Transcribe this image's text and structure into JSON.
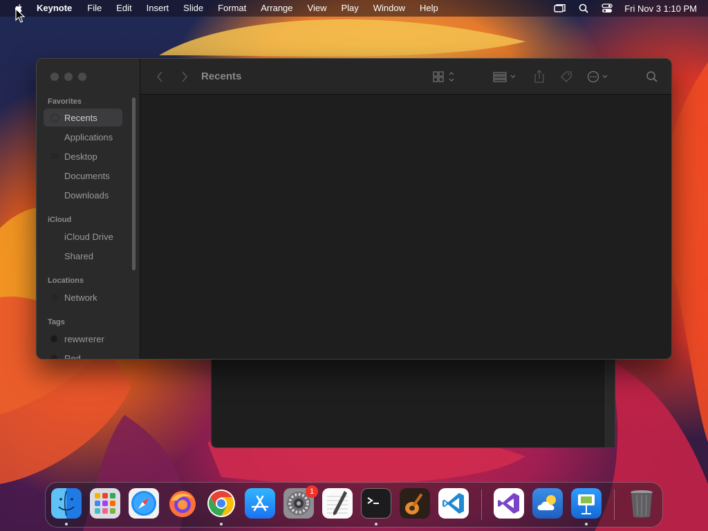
{
  "menubar": {
    "apple_icon": "apple-icon",
    "app_name": "Keynote",
    "items": [
      "File",
      "Edit",
      "Insert",
      "Slide",
      "Format",
      "Arrange",
      "View",
      "Play",
      "Window",
      "Help"
    ],
    "status_icons": [
      "screen-mirroring-icon",
      "spotlight-search-icon",
      "control-center-icon"
    ],
    "clock": "Fri Nov 3  1:10 PM"
  },
  "finder": {
    "title": "Recents",
    "toolbar_icons": [
      "back-icon",
      "forward-icon",
      "icon-view-icon",
      "group-by-icon",
      "share-icon",
      "tag-icon",
      "more-actions-icon",
      "search-icon"
    ],
    "sidebar": {
      "favorites_header": "Favorites",
      "favorites": [
        {
          "label": "Recents",
          "icon": "clock-icon"
        },
        {
          "label": "Applications",
          "icon": "applications-icon"
        },
        {
          "label": "Desktop",
          "icon": "desktop-icon"
        },
        {
          "label": "Documents",
          "icon": "document-icon"
        },
        {
          "label": "Downloads",
          "icon": "download-icon"
        }
      ],
      "icloud_header": "iCloud",
      "icloud": [
        {
          "label": "iCloud Drive",
          "icon": "cloud-icon"
        },
        {
          "label": "Shared",
          "icon": "shared-folder-icon"
        }
      ],
      "locations_header": "Locations",
      "locations": [
        {
          "label": "Network",
          "icon": "network-icon"
        }
      ],
      "tags_header": "Tags",
      "tags": [
        {
          "label": "rewwrerer",
          "color": "#1a1a1a"
        },
        {
          "label": "Red",
          "color": "#2a1a1a"
        }
      ]
    }
  },
  "dock": {
    "apps": [
      {
        "name": "Finder",
        "icon": "finder-icon",
        "running": true
      },
      {
        "name": "Launchpad",
        "icon": "launchpad-icon",
        "running": false
      },
      {
        "name": "Safari",
        "icon": "safari-icon",
        "running": false
      },
      {
        "name": "Firefox",
        "icon": "firefox-icon",
        "running": false
      },
      {
        "name": "Google Chrome",
        "icon": "chrome-icon",
        "running": true
      },
      {
        "name": "App Store",
        "icon": "app-store-icon",
        "running": false
      },
      {
        "name": "System Settings",
        "icon": "system-settings-icon",
        "running": false,
        "badge": "1"
      },
      {
        "name": "TextEdit",
        "icon": "textedit-icon",
        "running": false
      },
      {
        "name": "Terminal",
        "icon": "terminal-icon",
        "running": true
      },
      {
        "name": "GarageBand",
        "icon": "garageband-icon",
        "running": false
      },
      {
        "name": "Visual Studio Code",
        "icon": "vscode-icon",
        "running": false
      },
      {
        "name": "Visual Studio",
        "icon": "visual-studio-icon",
        "running": false
      },
      {
        "name": "Weather",
        "icon": "weather-icon",
        "running": false
      },
      {
        "name": "Keynote",
        "icon": "keynote-icon",
        "running": true
      },
      {
        "name": "Trash",
        "icon": "trash-icon",
        "running": false
      }
    ]
  }
}
